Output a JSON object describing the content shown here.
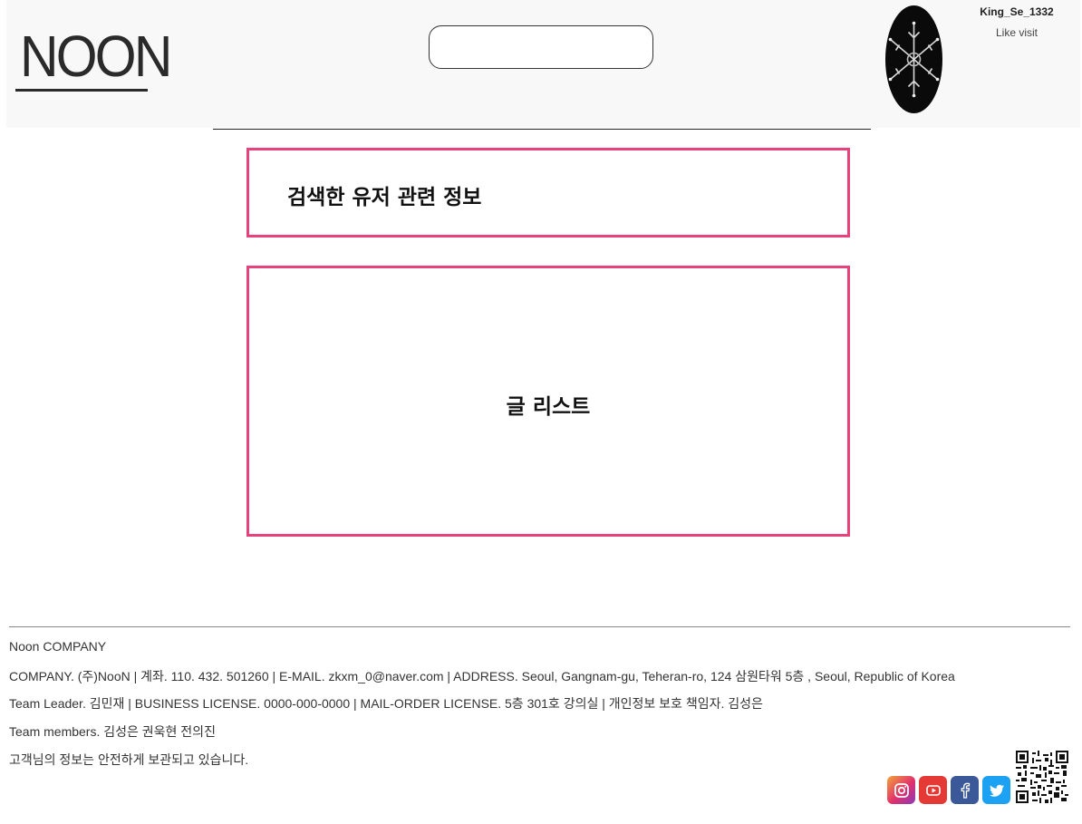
{
  "header": {
    "logo_text": "NOON",
    "search": {
      "value": "",
      "placeholder": ""
    },
    "user": {
      "username": "King_Se_1332",
      "status": "Like visit"
    }
  },
  "main": {
    "user_info_box": {
      "label": "검색한 유저 관련 정보"
    },
    "post_list_box": {
      "label": "글 리스트"
    }
  },
  "footer": {
    "company_name": "Noon COMPANY",
    "line_company": "COMPANY. (주)NooN | 계좌. 110. 432. 501260 | E-MAIL. zkxm_0@naver.com | ADDRESS. Seoul, Gangnam-gu, Teheran-ro, 124 삼원타워 5층 , Seoul, Republic of Korea",
    "line_license": "Team Leader. 김민재 | BUSINESS LICENSE. 0000-000-0000 | MAIL-ORDER LICENSE. 5층 301호 강의실 | 개인정보 보호 책임자. 김성은",
    "line_members": "Team members. 김성은 권욱현 전의진",
    "line_notice": "고객님의 정보는 안전하게 보관되고 있습니다.",
    "social_icons": [
      "instagram-icon",
      "youtube-icon",
      "facebook-icon",
      "twitter-icon"
    ],
    "qr_icon": "qr-code-icon"
  },
  "colors": {
    "accent_border": "#e8427d",
    "header_bg": "#f8f8f8",
    "instagram": "#e1306c",
    "youtube": "#e53935",
    "facebook": "#3b5998",
    "twitter": "#1da1f2"
  }
}
